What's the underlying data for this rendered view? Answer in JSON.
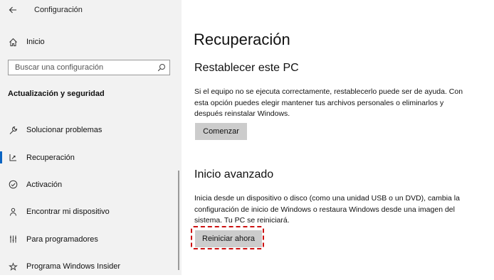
{
  "window": {
    "title": "Configuración"
  },
  "sidebar": {
    "home_label": "Inicio",
    "search_placeholder": "Buscar una configuración",
    "section_title": "Actualización y seguridad",
    "items": [
      {
        "label": "Solucionar problemas",
        "icon": "wrench-icon"
      },
      {
        "label": "Recuperación",
        "icon": "recovery-icon",
        "active": true
      },
      {
        "label": "Activación",
        "icon": "check-circle-icon"
      },
      {
        "label": "Encontrar mi dispositivo",
        "icon": "person-pin-icon"
      },
      {
        "label": "Para programadores",
        "icon": "developer-icon"
      },
      {
        "label": "Programa Windows Insider",
        "icon": "insider-icon"
      }
    ]
  },
  "main": {
    "title": "Recuperación",
    "reset": {
      "heading": "Restablecer este PC",
      "description": "Si el equipo no se ejecuta correctamente, restablecerlo puede ser de ayuda. Con esta opción puedes elegir mantener tus archivos personales o eliminarlos y después reinstalar Windows.",
      "button_label": "Comenzar"
    },
    "advanced": {
      "heading": "Inicio avanzado",
      "description": "Inicia desde un dispositivo o disco (como una unidad USB o un DVD), cambia la configuración de inicio de Windows o restaura Windows desde una imagen del sistema. Tu PC se reiniciará.",
      "button_label": "Reiniciar ahora"
    }
  },
  "colors": {
    "accent": "#0a64c2",
    "highlight": "#cc1111",
    "sidebar_bg": "#f2f2f2",
    "button_bg": "#cccccc"
  }
}
